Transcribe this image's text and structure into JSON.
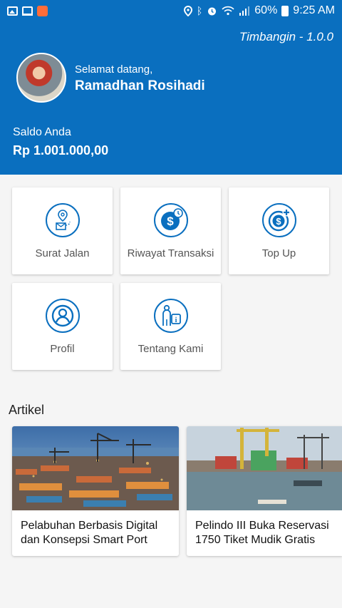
{
  "status_bar": {
    "battery_percent": "60%",
    "time": "9:25 AM",
    "left_icons": [
      "gallery-icon",
      "laptop-icon",
      "app-notification-icon"
    ],
    "right_icons": [
      "location-icon",
      "bluetooth-icon",
      "alarm-icon",
      "wifi-icon",
      "signal-icon",
      "battery-icon"
    ]
  },
  "header": {
    "app_version": "Timbangin - 1.0.0",
    "greeting": "Selamat datang,",
    "user_name": "Ramadhan Rosihadi",
    "balance_label": "Saldo Anda",
    "balance_value": "Rp 1.001.000,00",
    "color": "#0a6fbf"
  },
  "menu": {
    "items": [
      {
        "label": "Surat Jalan",
        "icon": "location-letter-icon"
      },
      {
        "label": "Riwayat Transaksi",
        "icon": "dollar-history-icon"
      },
      {
        "label": "Top Up",
        "icon": "dollar-plus-icon"
      },
      {
        "label": "Profil",
        "icon": "user-icon"
      },
      {
        "label": "Tentang Kami",
        "icon": "info-person-icon"
      }
    ]
  },
  "articles": {
    "title": "Artikel",
    "items": [
      {
        "title": "Pelabuhan Berbasis Digital dan Konsepsi Smart Port",
        "image": "port-containers-night-image"
      },
      {
        "title": "Pelindo III Buka Reservasi 1750 Tiket Mudik Gratis",
        "image": "port-cranes-harbor-image"
      }
    ]
  }
}
